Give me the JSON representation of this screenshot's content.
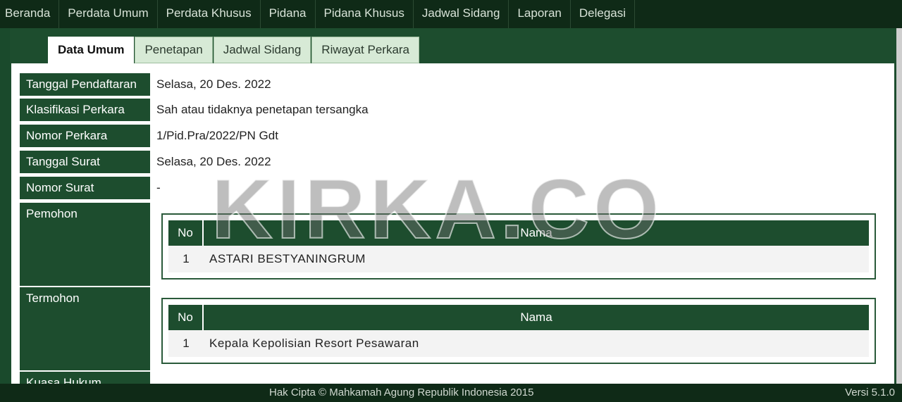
{
  "nav": {
    "items": [
      "Beranda",
      "Perdata Umum",
      "Perdata Khusus",
      "Pidana",
      "Pidana Khusus",
      "Jadwal Sidang",
      "Laporan",
      "Delegasi"
    ]
  },
  "tabs": [
    "Data Umum",
    "Penetapan",
    "Jadwal Sidang",
    "Riwayat Perkara"
  ],
  "info": {
    "rows": [
      {
        "label": "Tanggal Pendaftaran",
        "value": "Selasa, 20 Des. 2022"
      },
      {
        "label": "Klasifikasi Perkara",
        "value": "Sah atau tidaknya penetapan tersangka"
      },
      {
        "label": "Nomor Perkara",
        "value": "1/Pid.Pra/2022/PN Gdt"
      },
      {
        "label": "Tanggal Surat",
        "value": "Selasa, 20 Des. 2022"
      },
      {
        "label": "Nomor Surat",
        "value": "-"
      }
    ],
    "pemohon_label": "Pemohon",
    "termohon_label": "Termohon",
    "kuasa_label": "Kuasa Hukum"
  },
  "pemohon_table": {
    "headers": {
      "no": "No",
      "nama": "Nama"
    },
    "rows": [
      {
        "no": "1",
        "nama": "ASTARI BESTYANINGRUM"
      }
    ]
  },
  "termohon_table": {
    "headers": {
      "no": "No",
      "nama": "Nama"
    },
    "rows": [
      {
        "no": "1",
        "nama": "Kepala Kepolisian Resort Pesawaran"
      }
    ]
  },
  "watermark": "KIRKA.CO",
  "footer": {
    "copyright": "Hak Cipta © Mahkamah Agung Republik Indonesia 2015",
    "version": "Versi 5.1.0"
  },
  "colors": {
    "primary": "#1d4d2e",
    "nav_bg": "#0f2a17",
    "tab_bg": "#d7ead6"
  }
}
